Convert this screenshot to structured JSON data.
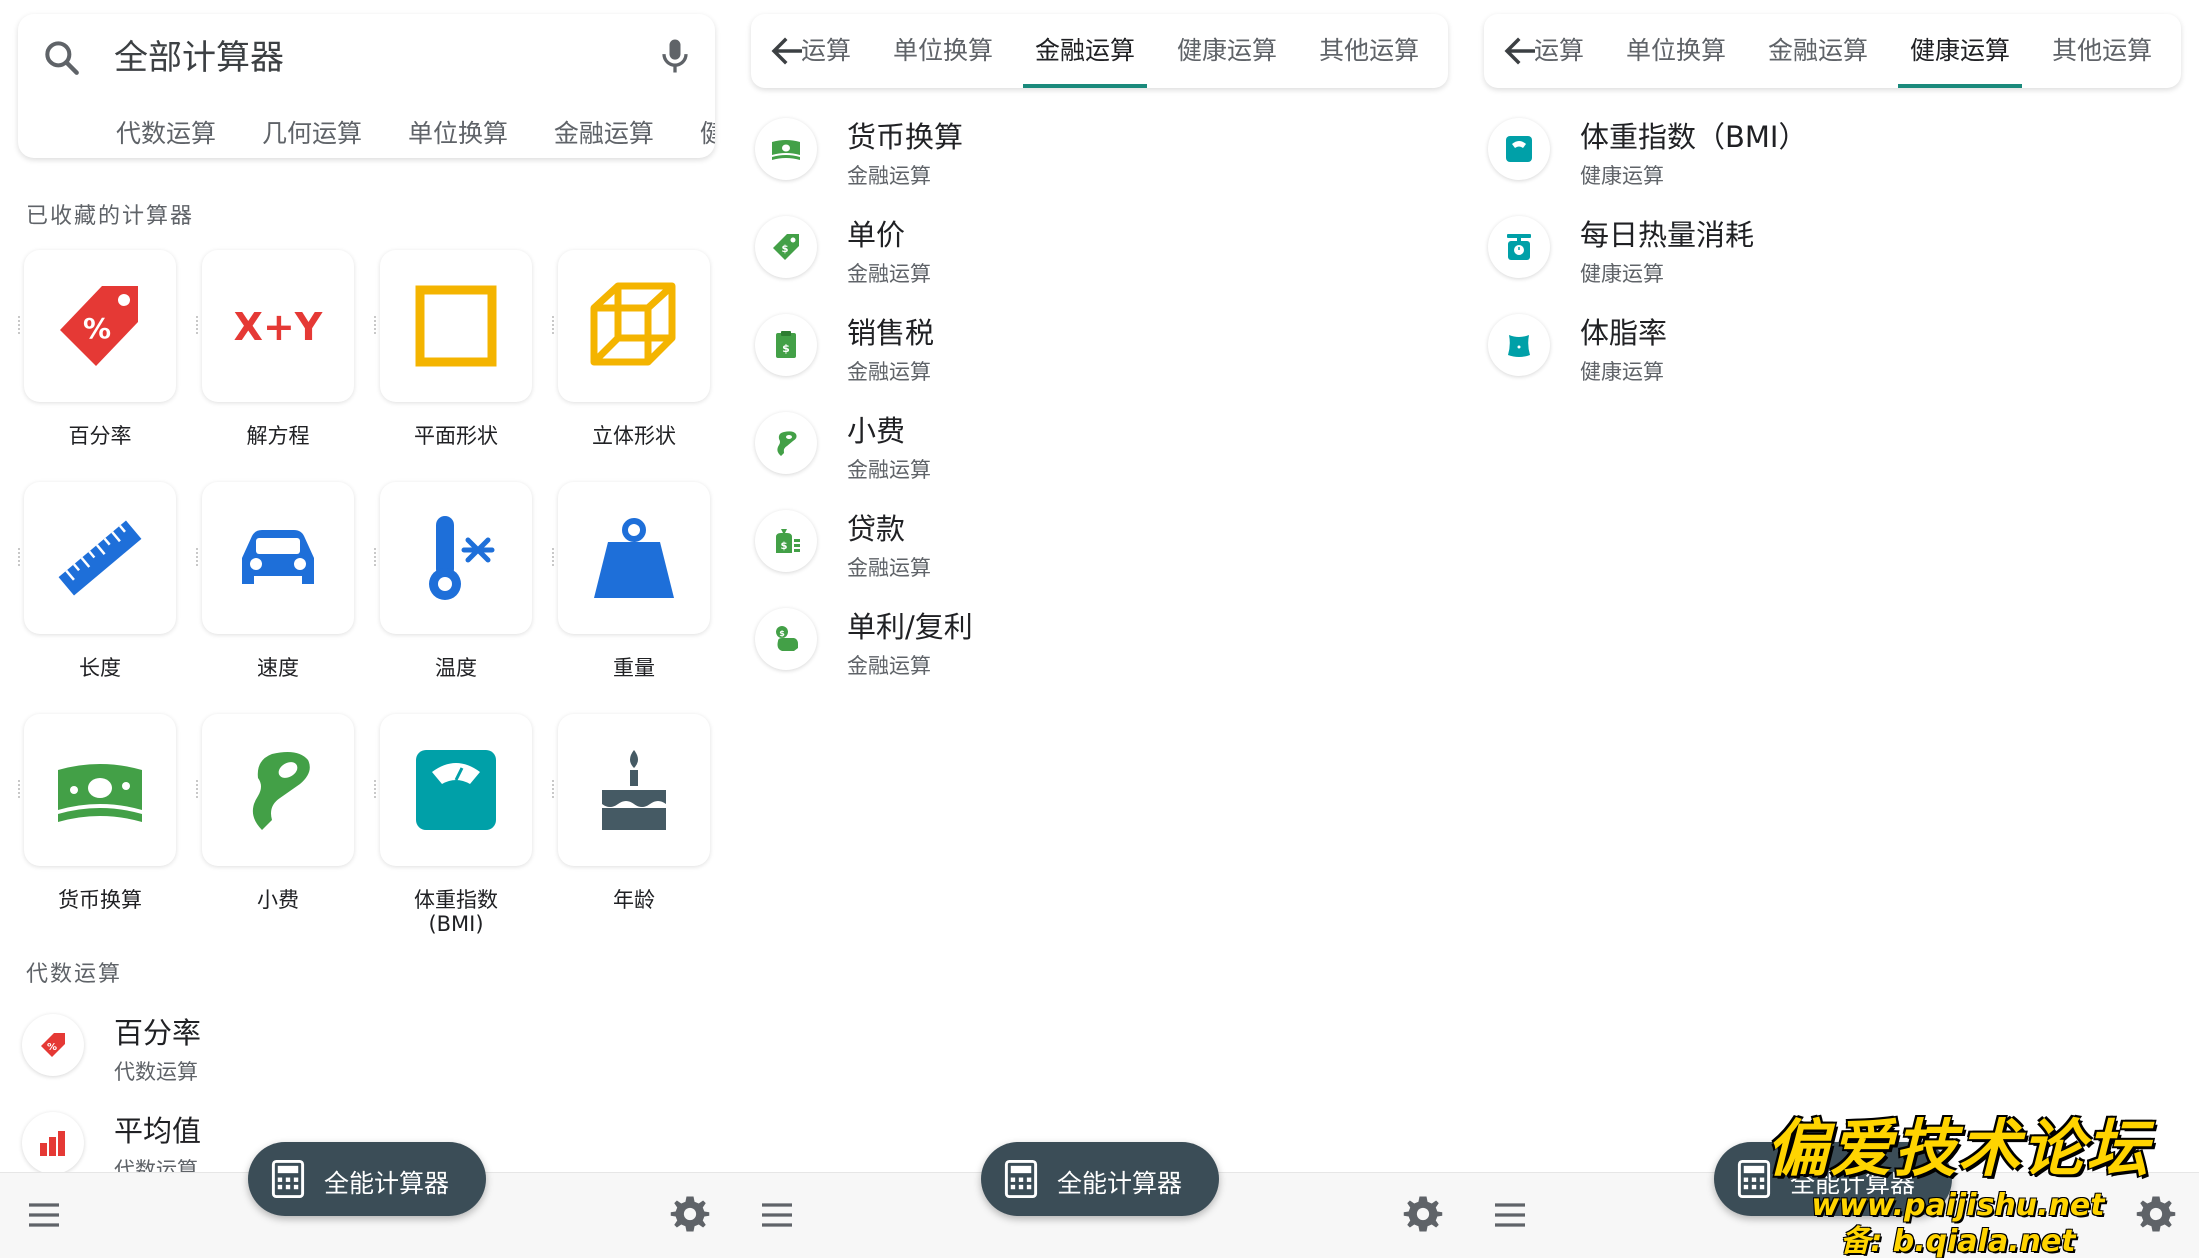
{
  "panel1": {
    "search": {
      "placeholder": "全部计算器"
    },
    "chips": [
      "代数运算",
      "几何运算",
      "单位换算",
      "金融运算",
      "健"
    ],
    "favorites_title": "已收藏的计算器",
    "favorites": [
      {
        "label": "百分率",
        "icon": "percent-tag-icon",
        "color": "#e53935"
      },
      {
        "label": "解方程",
        "icon": "x-plus-y-icon",
        "color": "#e53935"
      },
      {
        "label": "平面形状",
        "icon": "square-icon",
        "color": "#f4b400"
      },
      {
        "label": "立体形状",
        "icon": "cube-icon",
        "color": "#f4b400"
      },
      {
        "label": "长度",
        "icon": "ruler-icon",
        "color": "#1e6fd9"
      },
      {
        "label": "速度",
        "icon": "car-icon",
        "color": "#1e6fd9"
      },
      {
        "label": "温度",
        "icon": "thermometer-icon",
        "color": "#1e6fd9"
      },
      {
        "label": "重量",
        "icon": "weight-icon",
        "color": "#1e6fd9"
      },
      {
        "label": "货币换算",
        "icon": "money-icon",
        "color": "#43a047"
      },
      {
        "label": "小费",
        "icon": "tip-hand-icon",
        "color": "#43a047"
      },
      {
        "label": "体重指数\n(BMI)",
        "icon": "scale-icon",
        "color": "#00a0a8"
      },
      {
        "label": "年龄",
        "icon": "cake-icon",
        "color": "#455a64"
      }
    ],
    "algebra_title": "代数运算",
    "list": [
      {
        "title": "百分率",
        "sub": "代数运算",
        "icon": "percent-tag-icon"
      },
      {
        "title": "平均值",
        "sub": "代数运算",
        "icon": "bar-chart-icon"
      }
    ],
    "fab_label": "全能计算器"
  },
  "panel2": {
    "tabs": [
      "运算",
      "单位换算",
      "金融运算",
      "健康运算",
      "其他运算"
    ],
    "active_tab": "金融运算",
    "list": [
      {
        "title": "货币换算",
        "sub": "金融运算",
        "icon": "money-icon"
      },
      {
        "title": "单价",
        "sub": "金融运算",
        "icon": "price-tag-icon"
      },
      {
        "title": "销售税",
        "sub": "金融运算",
        "icon": "receipt-icon"
      },
      {
        "title": "小费",
        "sub": "金融运算",
        "icon": "tip-hand-icon"
      },
      {
        "title": "贷款",
        "sub": "金融运算",
        "icon": "loan-icon"
      },
      {
        "title": "单利/复利",
        "sub": "金融运算",
        "icon": "piggy-bank-icon"
      }
    ],
    "fab_label": "全能计算器"
  },
  "panel3": {
    "tabs": [
      "运算",
      "单位换算",
      "金融运算",
      "健康运算",
      "其他运算"
    ],
    "active_tab": "健康运算",
    "list": [
      {
        "title": "体重指数（BMI）",
        "sub": "健康运算",
        "icon": "scale-icon"
      },
      {
        "title": "每日热量消耗",
        "sub": "健康运算",
        "icon": "kitchen-scale-icon"
      },
      {
        "title": "体脂率",
        "sub": "健康运算",
        "icon": "body-icon"
      }
    ],
    "fab_label": "全能计算器"
  },
  "watermark": {
    "title": "偏爱技术论坛",
    "line1": "www.paijishu.net",
    "line2": "备: b.qiala.net"
  },
  "colors": {
    "accent": "#1a8a7c",
    "fab": "#3b4d57",
    "finance_green": "#43a047",
    "health_teal": "#00a0a8"
  }
}
